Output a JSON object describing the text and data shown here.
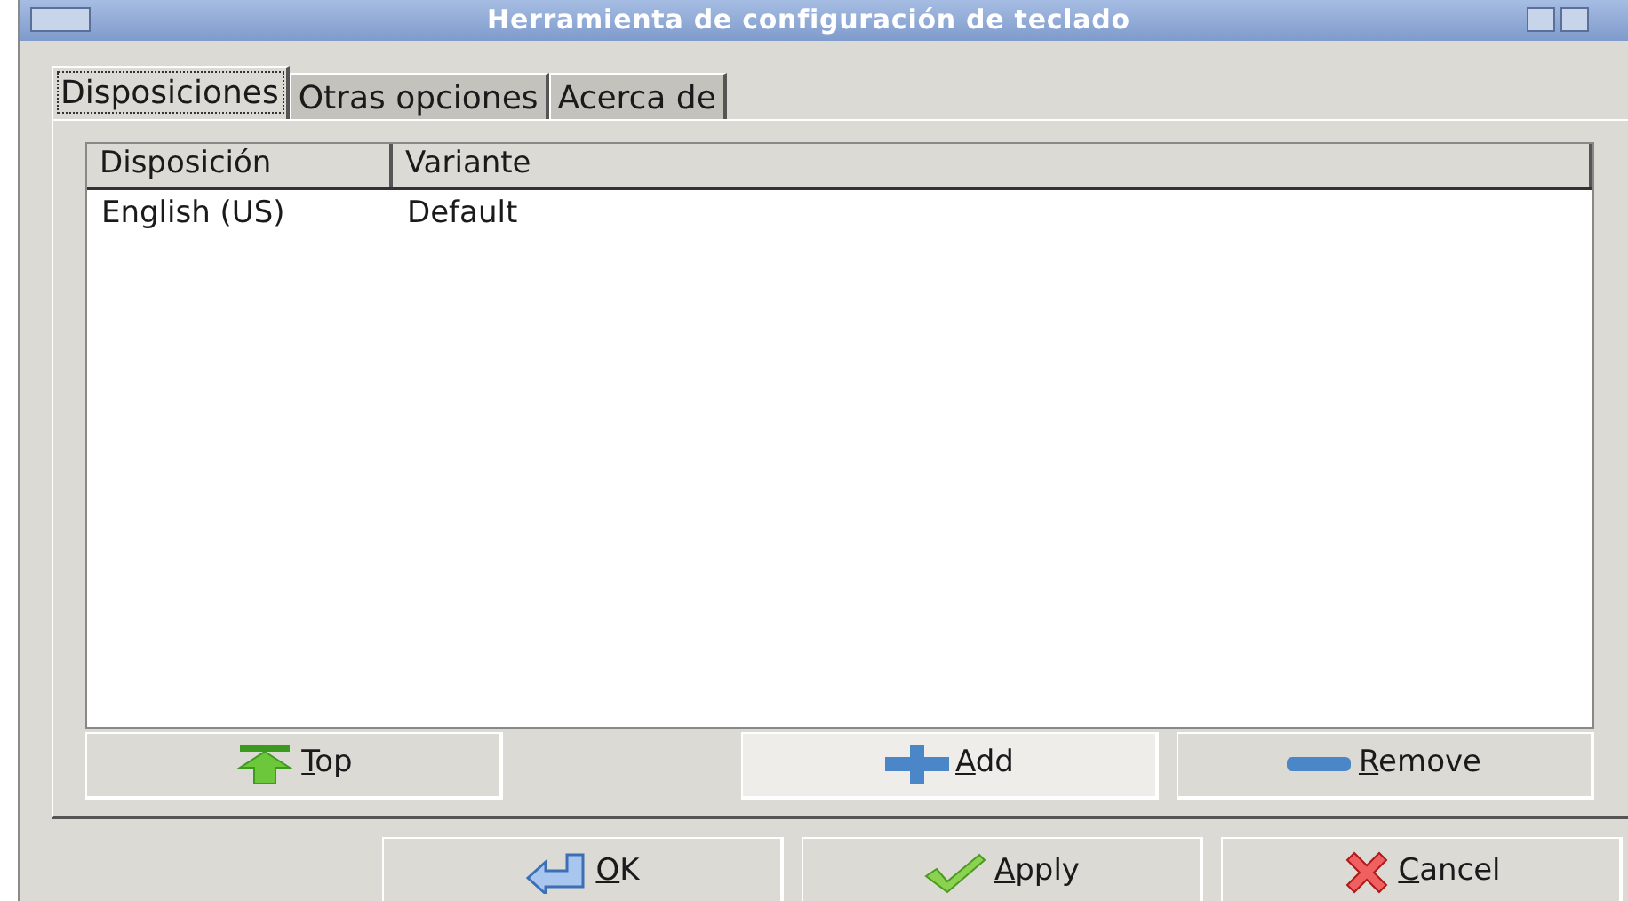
{
  "window": {
    "title": "Herramienta de configuración de teclado"
  },
  "tabs": [
    {
      "label": "Disposiciones",
      "selected": true
    },
    {
      "label": "Otras opciones",
      "selected": false
    },
    {
      "label": "Acerca de",
      "selected": false
    }
  ],
  "table": {
    "columns": [
      "Disposición",
      "Variante"
    ],
    "rows": [
      [
        "English (US)",
        "Default"
      ]
    ]
  },
  "list_buttons": [
    {
      "kind": "top",
      "mnemonic": "T",
      "rest": "op",
      "hovered": false
    },
    {
      "kind": "add",
      "mnemonic": "A",
      "rest": "dd",
      "hovered": true
    },
    {
      "kind": "remove",
      "mnemonic": "R",
      "rest": "emove",
      "hovered": false
    }
  ],
  "dialog_buttons": [
    {
      "kind": "ok",
      "mnemonic": "O",
      "rest": "K"
    },
    {
      "kind": "apply",
      "mnemonic": "A",
      "rest": "pply"
    },
    {
      "kind": "cancel",
      "mnemonic": "C",
      "rest": "ancel"
    }
  ]
}
